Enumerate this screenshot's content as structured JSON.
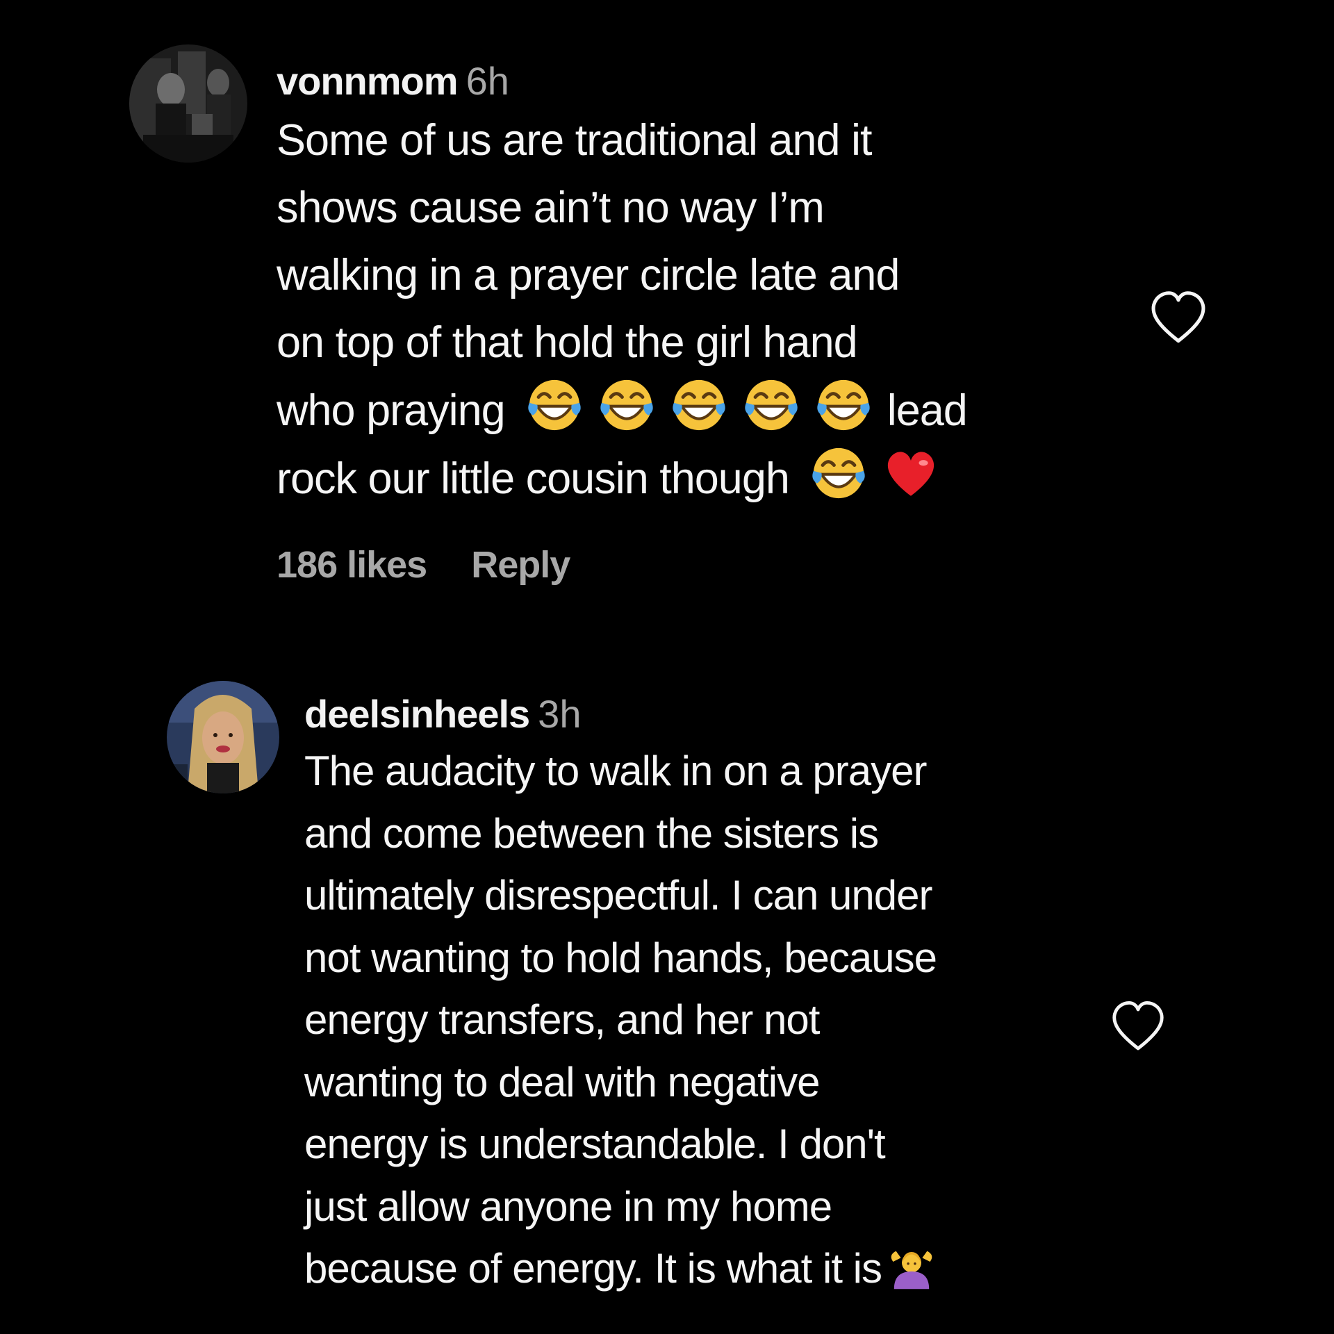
{
  "comments": [
    {
      "username": "vonnmom",
      "time": "6h",
      "lines": [
        "Some of us are traditional and it",
        "shows cause ain’t no way I’m",
        "walking in a prayer circle late and",
        "on top of that hold the girl hand",
        "who praying",
        "lead",
        "rock our little cousin though"
      ],
      "emoji_1": "face-with-tears-of-joy x5",
      "emoji_2": "face-with-tears-of-joy, red-heart",
      "likes": "186 likes",
      "reply_label": "Reply"
    },
    {
      "username": "deelsinheels",
      "time": "3h",
      "lines": [
        "The audacity to walk in on a prayer",
        "and come between the sisters is",
        "ultimately disrespectful. I can under",
        "not wanting to hold hands, because",
        "energy transfers, and her not",
        "wanting to deal with negative",
        "energy is understandable. I don't",
        "just allow anyone in my home",
        "because of energy. It is what it is"
      ],
      "emoji_end": "woman-shrugging"
    }
  ],
  "colors": {
    "background": "#000000",
    "text": "#f5f5f5",
    "muted": "#a8a8a8",
    "heart_outline": "#f5f5f5",
    "emoji_face": "#f6c33b",
    "emoji_tears": "#4aa3e8",
    "red_heart": "#e8202a"
  },
  "icons": [
    "avatar",
    "heart-outline-icon",
    "tears-of-joy-emoji",
    "red-heart-emoji",
    "woman-shrugging-emoji"
  ]
}
